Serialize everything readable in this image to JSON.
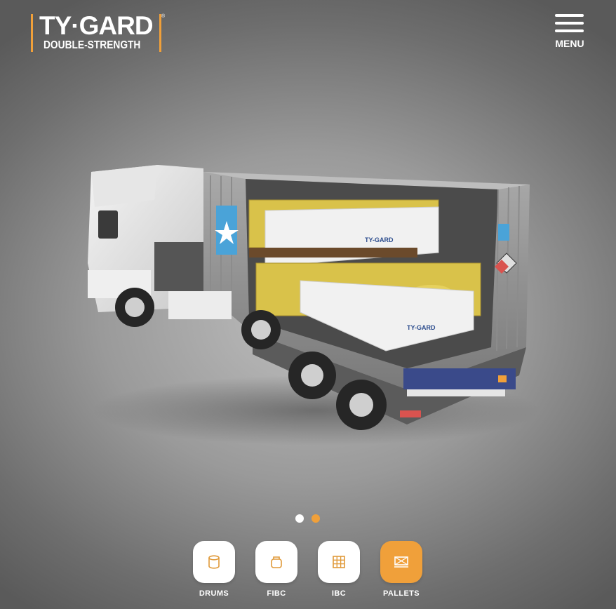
{
  "header": {
    "brand": "TY·GARD",
    "registered_mark": "®",
    "tagline": "DOUBLE-STRENGTH",
    "menu_label": "MENU"
  },
  "hero": {
    "container_label": "TY-GARD"
  },
  "carousel": {
    "slide_count": 2,
    "active_slide": 2
  },
  "categories": [
    {
      "label": "DRUMS",
      "icon": "drum-icon",
      "active": false
    },
    {
      "label": "FIBC",
      "icon": "bag-icon",
      "active": false
    },
    {
      "label": "IBC",
      "icon": "grid-tote-icon",
      "active": false
    },
    {
      "label": "PALLETS",
      "icon": "pallet-icon",
      "active": true
    }
  ],
  "colors": {
    "accent": "#f0a03a",
    "text": "#ffffff",
    "tile": "#ffffff",
    "icon": "#e09a3a"
  }
}
